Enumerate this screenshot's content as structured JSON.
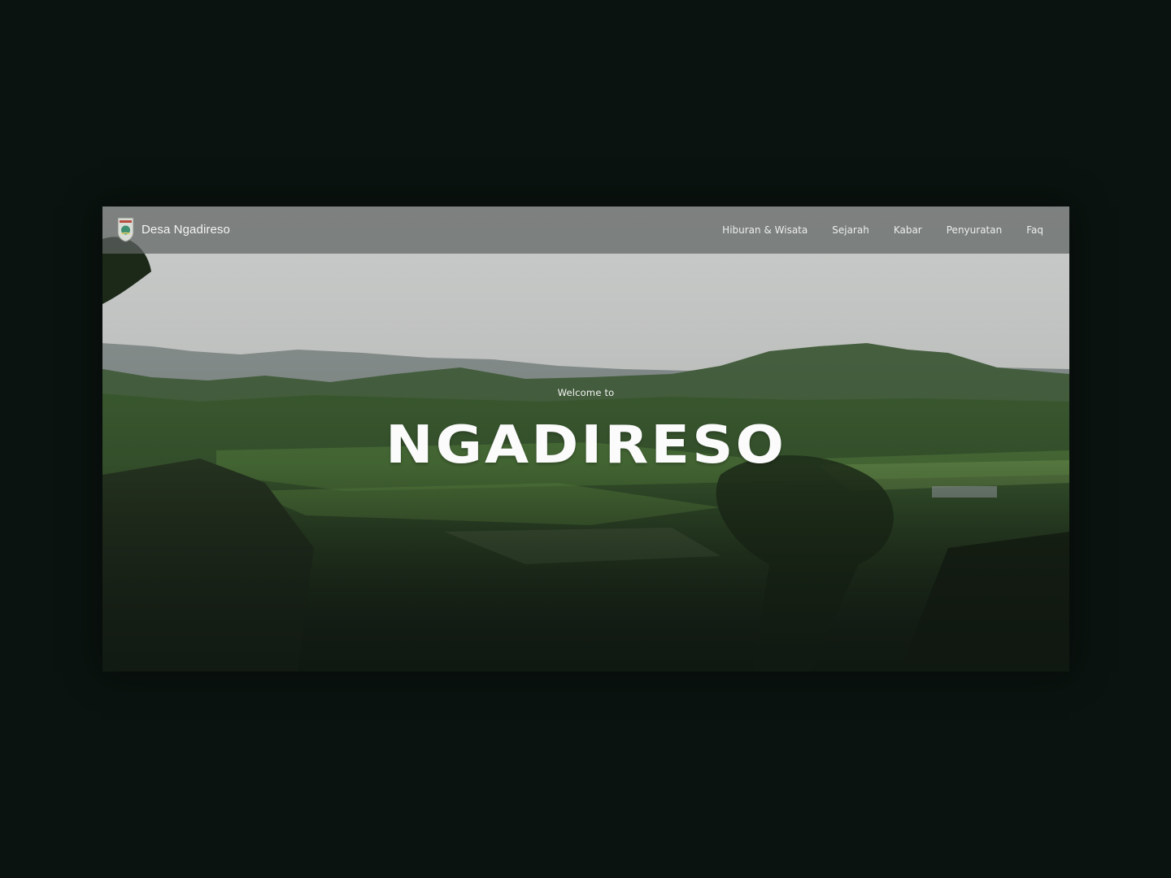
{
  "brand": {
    "name": "Desa Ngadireso",
    "logo_icon": "village-emblem-icon"
  },
  "nav": {
    "items": [
      {
        "label": "Hiburan & Wisata"
      },
      {
        "label": "Sejarah"
      },
      {
        "label": "Kabar"
      },
      {
        "label": "Penyuratan"
      },
      {
        "label": "Faq"
      }
    ]
  },
  "hero": {
    "subtitle": "Welcome to",
    "title": "NGADIRESO",
    "background_icon": "rice-field-landscape-photo"
  },
  "colors": {
    "page_background": "#0a130f",
    "navbar": "#5f6462",
    "text": "#ffffff"
  }
}
